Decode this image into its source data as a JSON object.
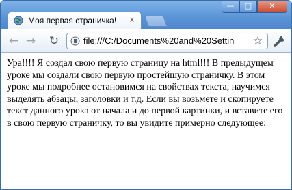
{
  "browser": {
    "tab": {
      "title": "Моя первая страничка!",
      "close_label": "×",
      "favicon": "globe-icon"
    },
    "window_buttons": {
      "minimize": "—",
      "maximize": "□",
      "close": "✕"
    },
    "toolbar": {
      "back_icon": "back-arrow-icon",
      "forward_icon": "forward-arrow-icon",
      "reload_icon": "reload-icon",
      "back_glyph": "←",
      "forward_glyph": "→",
      "reload_glyph": "↻",
      "address": "file:///C:/Documents%20and%20Settin",
      "star_glyph": "☆",
      "menu_icon": "wrench-icon"
    }
  },
  "page": {
    "paragraph": "Ура!!!! Я создал свою первую страницу на html!!! В предыдущем уроке мы создали свою первую простейшую страничку. В этом уроке мы подробнее остановимся на свойствах текста, научимся выделять абзацы, заголовки и т.д. Если вы возьмете и скопируете текст данного урока от начала и до первой картинки, и вставите его в свою первую страничку, то вы увидите примерно следующее:"
  }
}
